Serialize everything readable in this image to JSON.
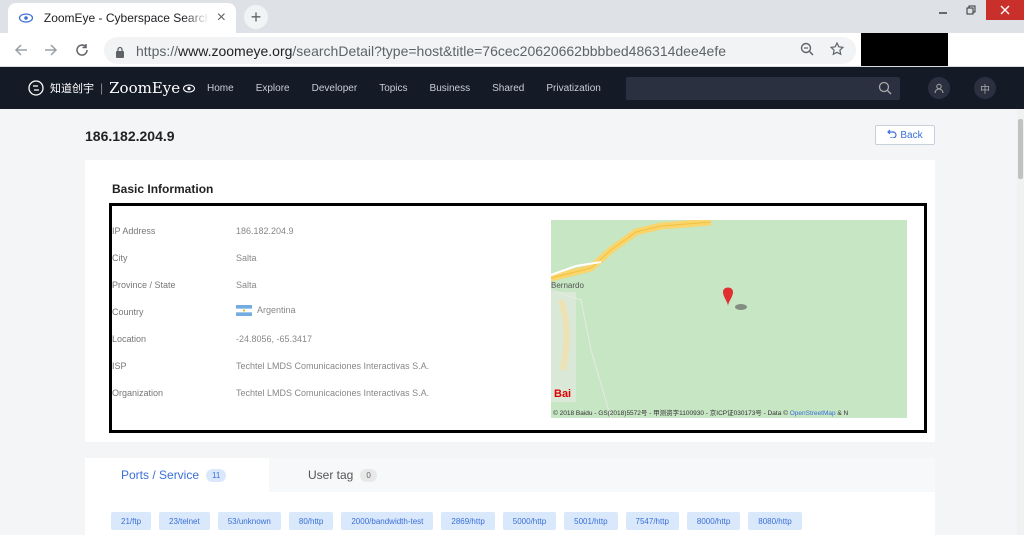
{
  "browser": {
    "tab_title": "ZoomEye - Cyberspace Search Engine",
    "tab_close": "×",
    "new_tab": "+",
    "url_prefix": "https://",
    "url_host": "www.zoomeye.org",
    "url_path": "/searchDetail?type=host&title=76cec20620662bbbbed486314dee4efe"
  },
  "site": {
    "logo_cn": "知道创宇",
    "logo_sep": "|",
    "logo_brand": "ZoomEye",
    "nav": [
      "Home",
      "Explore",
      "Developer",
      "Topics",
      "Business",
      "Shared",
      "Privatization"
    ],
    "lang_toggle": "中"
  },
  "page": {
    "ip_title": "186.182.204.9",
    "back_label": "Back"
  },
  "basic_info": {
    "heading": "Basic Information",
    "rows": [
      {
        "label": "IP Address",
        "value": "186.182.204.9"
      },
      {
        "label": "City",
        "value": "Salta"
      },
      {
        "label": "Province / State",
        "value": "Salta"
      },
      {
        "label": "Country",
        "value": "Argentina"
      },
      {
        "label": "Location",
        "value": "-24.8056, -65.3417"
      },
      {
        "label": "ISP",
        "value": "Techtel LMDS Comunicaciones Interactivas S.A."
      },
      {
        "label": "Organization",
        "value": "Techtel LMDS Comunicaciones Interactivas S.A."
      }
    ]
  },
  "map": {
    "place_label": "Bernardo",
    "baidu_logo": "Bai",
    "copyright": "© 2018 Baidu - GS(2018)5572号 - 甲测资字1100930 - 京ICP证030173号 - Data © ",
    "osm": "OpenStreetMap",
    "copyright_tail": " & N"
  },
  "tabs": {
    "ports_label": "Ports / Service",
    "ports_count": "11",
    "user_tag_label": "User tag",
    "user_tag_count": "0"
  },
  "ports": [
    "21/ftp",
    "23/telnet",
    "53/unknown",
    "80/http",
    "2000/bandwidth-test",
    "2869/http",
    "5000/http",
    "5001/http",
    "7547/http",
    "8000/http",
    "8080/http"
  ]
}
